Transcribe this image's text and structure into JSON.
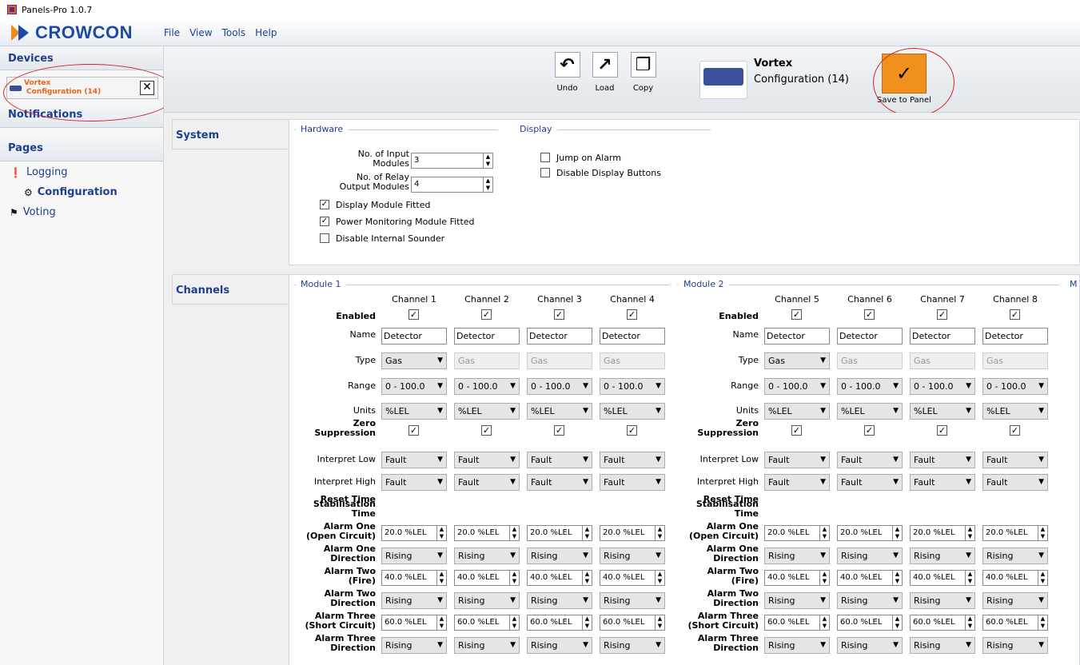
{
  "window": {
    "title": "Panels-Pro 1.0.7"
  },
  "logo": {
    "text": "CROWCON"
  },
  "menu": [
    "File",
    "View",
    "Tools",
    "Help"
  ],
  "sidebar": {
    "devices_label": "Devices",
    "device": {
      "name": "Vortex",
      "config": "Configuration (14)"
    },
    "notifications_label": "Notifications",
    "pages_label": "Pages",
    "pages": [
      {
        "label": "Logging",
        "icon": "exclamation-icon"
      },
      {
        "label": "Configuration",
        "icon": "gear-icon",
        "active": true
      },
      {
        "label": "Voting",
        "icon": "flag-icon"
      }
    ]
  },
  "toolbar": {
    "undo_label": "Undo",
    "load_label": "Load",
    "copy_label": "Copy",
    "device_name": "Vortex",
    "device_config": "Configuration (14)",
    "save_label": "Save to Panel",
    "accent": "#f0911f"
  },
  "system": {
    "section_label": "System",
    "hardware_label": "Hardware",
    "display_label": "Display",
    "input_modules_label": "No. of Input Modules",
    "input_modules_value": "3",
    "relay_modules_label": "No. of Relay Output Modules",
    "relay_modules_value": "4",
    "display_fitted_label": "Display Module Fitted",
    "display_fitted": true,
    "power_fitted_label": "Power Monitoring Module Fitted",
    "power_fitted": true,
    "disable_sounder_label": "Disable Internal Sounder",
    "disable_sounder": false,
    "jump_alarm_label": "Jump on Alarm",
    "jump_alarm": false,
    "disable_buttons_label": "Disable Display Buttons",
    "disable_buttons": false
  },
  "channels": {
    "section_label": "Channels",
    "row_labels": {
      "enabled": "Enabled",
      "name": "Name",
      "type": "Type",
      "range": "Range",
      "units": "Units",
      "zero1": "Zero",
      "zero2": "Suppression",
      "interp_low": "Interpret Low",
      "interp_high": "Interpret High",
      "reset_time": "Reset Time",
      "stab1": "Stabilisation",
      "stab2": "Time",
      "a1_1": "Alarm One",
      "a1_2": "(Open Circuit)",
      "a1d_1": "Alarm One",
      "a1d_2": "Direction",
      "a2_1": "Alarm Two",
      "a2_2": "(Fire)",
      "a2d_1": "Alarm Two",
      "a2d_2": "Direction",
      "a3_1": "Alarm Three",
      "a3_2": "(Short Circuit)",
      "a3d_1": "Alarm Three",
      "a3d_2": "Direction"
    },
    "modules": [
      {
        "title": "Module 1",
        "channels": [
          {
            "label": "Channel 1",
            "name": "Detector",
            "type": "Gas",
            "range": "0 - 100.0",
            "units": "%LEL",
            "interp_low": "Fault",
            "interp_high": "Fault",
            "alarm1": "20.0 %LEL",
            "alarm1_dir": "Rising",
            "alarm2": "40.0 %LEL",
            "alarm2_dir": "Rising",
            "alarm3": "60.0 %LEL",
            "alarm3_dir": "Rising"
          },
          {
            "label": "Channel 2",
            "name": "Detector",
            "type": "Gas",
            "range": "0 - 100.0",
            "units": "%LEL",
            "interp_low": "Fault",
            "interp_high": "Fault",
            "alarm1": "20.0 %LEL",
            "alarm1_dir": "Rising",
            "alarm2": "40.0 %LEL",
            "alarm2_dir": "Rising",
            "alarm3": "60.0 %LEL",
            "alarm3_dir": "Rising"
          },
          {
            "label": "Channel 3",
            "name": "Detector",
            "type": "Gas",
            "range": "0 - 100.0",
            "units": "%LEL",
            "interp_low": "Fault",
            "interp_high": "Fault",
            "alarm1": "20.0 %LEL",
            "alarm1_dir": "Rising",
            "alarm2": "40.0 %LEL",
            "alarm2_dir": "Rising",
            "alarm3": "60.0 %LEL",
            "alarm3_dir": "Rising"
          },
          {
            "label": "Channel 4",
            "name": "Detector",
            "type": "Gas",
            "range": "0 - 100.0",
            "units": "%LEL",
            "interp_low": "Fault",
            "interp_high": "Fault",
            "alarm1": "20.0 %LEL",
            "alarm1_dir": "Rising",
            "alarm2": "40.0 %LEL",
            "alarm2_dir": "Rising",
            "alarm3": "60.0 %LEL",
            "alarm3_dir": "Rising"
          }
        ]
      },
      {
        "title": "Module 2",
        "channels": [
          {
            "label": "Channel 5",
            "name": "Detector",
            "type": "Gas",
            "range": "0 - 100.0",
            "units": "%LEL",
            "interp_low": "Fault",
            "interp_high": "Fault",
            "alarm1": "20.0 %LEL",
            "alarm1_dir": "Rising",
            "alarm2": "40.0 %LEL",
            "alarm2_dir": "Rising",
            "alarm3": "60.0 %LEL",
            "alarm3_dir": "Rising"
          },
          {
            "label": "Channel 6",
            "name": "Detector",
            "type": "Gas",
            "range": "0 - 100.0",
            "units": "%LEL",
            "interp_low": "Fault",
            "interp_high": "Fault",
            "alarm1": "20.0 %LEL",
            "alarm1_dir": "Rising",
            "alarm2": "40.0 %LEL",
            "alarm2_dir": "Rising",
            "alarm3": "60.0 %LEL",
            "alarm3_dir": "Rising"
          },
          {
            "label": "Channel 7",
            "name": "Detector",
            "type": "Gas",
            "range": "0 - 100.0",
            "units": "%LEL",
            "interp_low": "Fault",
            "interp_high": "Fault",
            "alarm1": "20.0 %LEL",
            "alarm1_dir": "Rising",
            "alarm2": "40.0 %LEL",
            "alarm2_dir": "Rising",
            "alarm3": "60.0 %LEL",
            "alarm3_dir": "Rising"
          },
          {
            "label": "Channel 8",
            "name": "Detector",
            "type": "Gas",
            "range": "0 - 100.0",
            "units": "%LEL",
            "interp_low": "Fault",
            "interp_high": "Fault",
            "alarm1": "20.0 %LEL",
            "alarm1_dir": "Rising",
            "alarm2": "40.0 %LEL",
            "alarm2_dir": "Rising",
            "alarm3": "60.0 %LEL",
            "alarm3_dir": "Rising"
          }
        ]
      },
      {
        "title": "M",
        "channels": []
      }
    ]
  }
}
